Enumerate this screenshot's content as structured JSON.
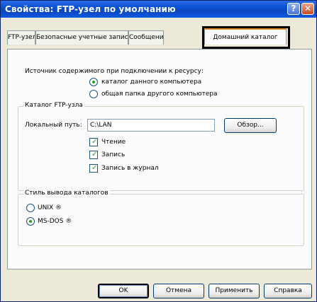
{
  "window": {
    "title": "Свойства: FTP-узел по умолчанию",
    "help_glyph": "?",
    "close_glyph": "✕"
  },
  "tabs": [
    {
      "label": "FTP-узел"
    },
    {
      "label": "Безопасные учетные записи"
    },
    {
      "label": "Сообщени"
    },
    {
      "label": "Домашний каталог"
    }
  ],
  "source": {
    "heading": "Источник содержимого при подключении к ресурсу:",
    "options": [
      {
        "label": "каталог данного компьютера",
        "selected": true
      },
      {
        "label": "общая папка другого компьютера",
        "selected": false
      }
    ]
  },
  "ftp_dir_group": {
    "label": "Каталог FTP-узла",
    "local_path_label": "Локальный путь:",
    "local_path_value": "C:\\LAN",
    "browse_button": "Обзор...",
    "checkboxes": [
      {
        "label": "Чтение",
        "checked": true
      },
      {
        "label": "Запись",
        "checked": true
      },
      {
        "label": "Запись в журнал",
        "checked": true
      }
    ]
  },
  "listing_style_group": {
    "label": "Стиль вывода каталогов",
    "options": [
      {
        "label": "UNIX ®",
        "selected": false
      },
      {
        "label": "MS-DOS ®",
        "selected": true
      }
    ]
  },
  "buttons": {
    "ok": "OK",
    "cancel": "Отмена",
    "apply": "Применить",
    "help": "Справка"
  },
  "colors": {
    "titlebar": "#0b46c2",
    "active_tab_accent": "#e68b2c",
    "radio_dot": "#21a121"
  }
}
